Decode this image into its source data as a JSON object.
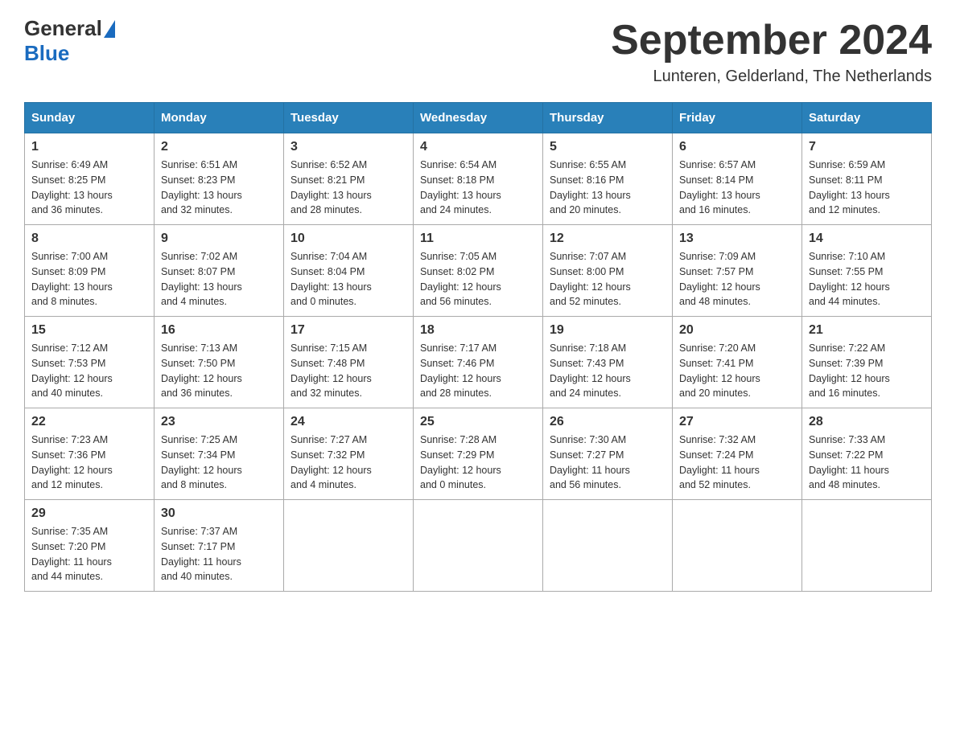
{
  "header": {
    "logo_general": "General",
    "logo_blue": "Blue",
    "month_title": "September 2024",
    "location": "Lunteren, Gelderland, The Netherlands"
  },
  "calendar": {
    "days_of_week": [
      "Sunday",
      "Monday",
      "Tuesday",
      "Wednesday",
      "Thursday",
      "Friday",
      "Saturday"
    ],
    "weeks": [
      [
        {
          "day": "1",
          "sunrise": "6:49 AM",
          "sunset": "8:25 PM",
          "daylight": "13 hours and 36 minutes."
        },
        {
          "day": "2",
          "sunrise": "6:51 AM",
          "sunset": "8:23 PM",
          "daylight": "13 hours and 32 minutes."
        },
        {
          "day": "3",
          "sunrise": "6:52 AM",
          "sunset": "8:21 PM",
          "daylight": "13 hours and 28 minutes."
        },
        {
          "day": "4",
          "sunrise": "6:54 AM",
          "sunset": "8:18 PM",
          "daylight": "13 hours and 24 minutes."
        },
        {
          "day": "5",
          "sunrise": "6:55 AM",
          "sunset": "8:16 PM",
          "daylight": "13 hours and 20 minutes."
        },
        {
          "day": "6",
          "sunrise": "6:57 AM",
          "sunset": "8:14 PM",
          "daylight": "13 hours and 16 minutes."
        },
        {
          "day": "7",
          "sunrise": "6:59 AM",
          "sunset": "8:11 PM",
          "daylight": "13 hours and 12 minutes."
        }
      ],
      [
        {
          "day": "8",
          "sunrise": "7:00 AM",
          "sunset": "8:09 PM",
          "daylight": "13 hours and 8 minutes."
        },
        {
          "day": "9",
          "sunrise": "7:02 AM",
          "sunset": "8:07 PM",
          "daylight": "13 hours and 4 minutes."
        },
        {
          "day": "10",
          "sunrise": "7:04 AM",
          "sunset": "8:04 PM",
          "daylight": "13 hours and 0 minutes."
        },
        {
          "day": "11",
          "sunrise": "7:05 AM",
          "sunset": "8:02 PM",
          "daylight": "12 hours and 56 minutes."
        },
        {
          "day": "12",
          "sunrise": "7:07 AM",
          "sunset": "8:00 PM",
          "daylight": "12 hours and 52 minutes."
        },
        {
          "day": "13",
          "sunrise": "7:09 AM",
          "sunset": "7:57 PM",
          "daylight": "12 hours and 48 minutes."
        },
        {
          "day": "14",
          "sunrise": "7:10 AM",
          "sunset": "7:55 PM",
          "daylight": "12 hours and 44 minutes."
        }
      ],
      [
        {
          "day": "15",
          "sunrise": "7:12 AM",
          "sunset": "7:53 PM",
          "daylight": "12 hours and 40 minutes."
        },
        {
          "day": "16",
          "sunrise": "7:13 AM",
          "sunset": "7:50 PM",
          "daylight": "12 hours and 36 minutes."
        },
        {
          "day": "17",
          "sunrise": "7:15 AM",
          "sunset": "7:48 PM",
          "daylight": "12 hours and 32 minutes."
        },
        {
          "day": "18",
          "sunrise": "7:17 AM",
          "sunset": "7:46 PM",
          "daylight": "12 hours and 28 minutes."
        },
        {
          "day": "19",
          "sunrise": "7:18 AM",
          "sunset": "7:43 PM",
          "daylight": "12 hours and 24 minutes."
        },
        {
          "day": "20",
          "sunrise": "7:20 AM",
          "sunset": "7:41 PM",
          "daylight": "12 hours and 20 minutes."
        },
        {
          "day": "21",
          "sunrise": "7:22 AM",
          "sunset": "7:39 PM",
          "daylight": "12 hours and 16 minutes."
        }
      ],
      [
        {
          "day": "22",
          "sunrise": "7:23 AM",
          "sunset": "7:36 PM",
          "daylight": "12 hours and 12 minutes."
        },
        {
          "day": "23",
          "sunrise": "7:25 AM",
          "sunset": "7:34 PM",
          "daylight": "12 hours and 8 minutes."
        },
        {
          "day": "24",
          "sunrise": "7:27 AM",
          "sunset": "7:32 PM",
          "daylight": "12 hours and 4 minutes."
        },
        {
          "day": "25",
          "sunrise": "7:28 AM",
          "sunset": "7:29 PM",
          "daylight": "12 hours and 0 minutes."
        },
        {
          "day": "26",
          "sunrise": "7:30 AM",
          "sunset": "7:27 PM",
          "daylight": "11 hours and 56 minutes."
        },
        {
          "day": "27",
          "sunrise": "7:32 AM",
          "sunset": "7:24 PM",
          "daylight": "11 hours and 52 minutes."
        },
        {
          "day": "28",
          "sunrise": "7:33 AM",
          "sunset": "7:22 PM",
          "daylight": "11 hours and 48 minutes."
        }
      ],
      [
        {
          "day": "29",
          "sunrise": "7:35 AM",
          "sunset": "7:20 PM",
          "daylight": "11 hours and 44 minutes."
        },
        {
          "day": "30",
          "sunrise": "7:37 AM",
          "sunset": "7:17 PM",
          "daylight": "11 hours and 40 minutes."
        },
        null,
        null,
        null,
        null,
        null
      ]
    ],
    "labels": {
      "sunrise": "Sunrise:",
      "sunset": "Sunset:",
      "daylight": "Daylight:"
    }
  }
}
